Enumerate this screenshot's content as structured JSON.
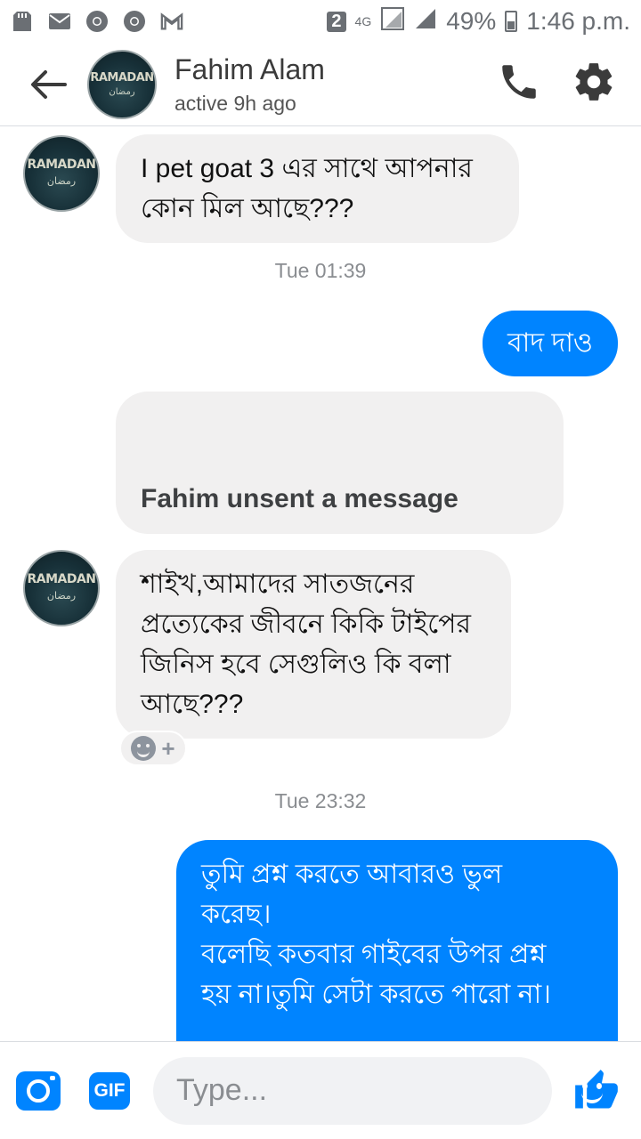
{
  "status_bar": {
    "sim_badge": "2",
    "network": "4G",
    "battery": "49%",
    "time": "1:46 p.m.",
    "icons": [
      "sd-card-icon",
      "mail-icon",
      "chrome-icon",
      "chrome-icon",
      "gmail-icon"
    ]
  },
  "header": {
    "contact_name": "Fahim Alam",
    "status": "active 9h ago",
    "avatar_text": "RAMADAN",
    "avatar_subtext": "رمضان"
  },
  "messages": [
    {
      "type": "incoming",
      "text_line1": "I pet goat 3 এর সাথে আপনার",
      "text_line2": "কোন মিল আছে???"
    },
    {
      "type": "timestamp",
      "text": "Tue 01:39"
    },
    {
      "type": "outgoing",
      "text": "বাদ দাও"
    },
    {
      "type": "unsent",
      "text": "Fahim unsent a message"
    },
    {
      "type": "incoming",
      "text_line1": "শাইখ,আমাদের সাতজনের",
      "text_line2": "প্রত্যেকের জীবনে কিকি টাইপের",
      "text_line3": "জিনিস হবে সেগুলিও কি বলা",
      "text_line4": "আছে???"
    },
    {
      "type": "timestamp",
      "text": "Tue 23:32"
    },
    {
      "type": "outgoing",
      "text_line1": "তুমি প্রশ্ন করতে আবারও ভুল",
      "text_line2": "করেছ।",
      "text_line3": "বলেছি কতবার গাইবের উপর প্রশ্ন",
      "text_line4": "হয় না।তুমি সেটা করতে পারো না।"
    }
  ],
  "composer": {
    "placeholder": "Type...",
    "gif_label": "GIF"
  },
  "colors": {
    "accent": "#0084ff",
    "incoming_bubble": "#f1f0f0"
  }
}
